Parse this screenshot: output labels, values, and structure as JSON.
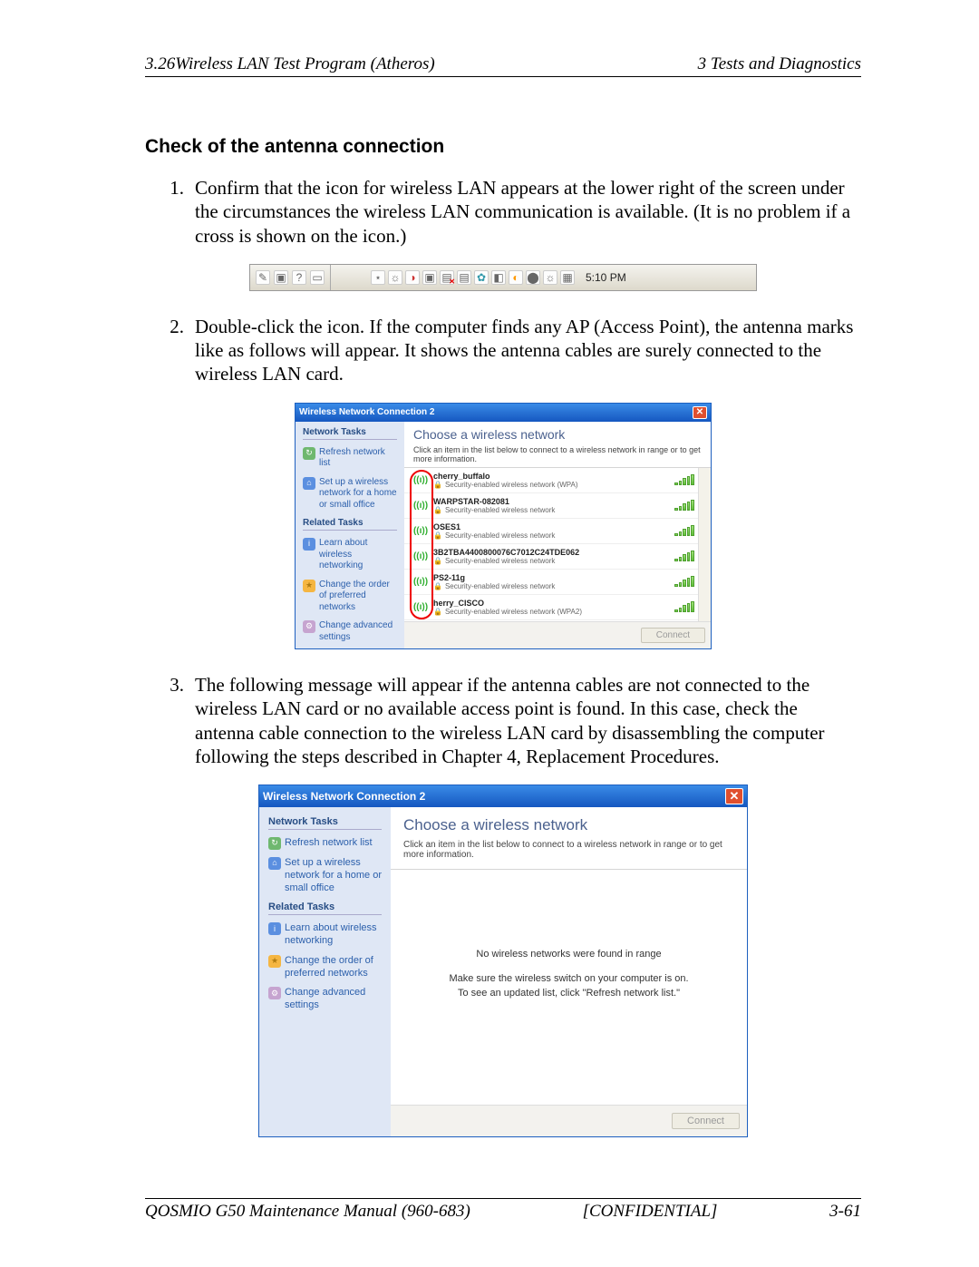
{
  "header": {
    "left": "3.26Wireless LAN Test Program (Atheros)",
    "right": "3  Tests and Diagnostics"
  },
  "section_title": "Check of the antenna connection",
  "steps": [
    {
      "num": "1.",
      "text": "Confirm that the icon for wireless LAN appears at the lower right of the screen under the circumstances the wireless LAN communication is available. (It is no problem if a cross is shown on the icon.)"
    },
    {
      "num": "2.",
      "text": "Double-click the icon. If the computer finds any AP (Access Point), the antenna marks like as follows will appear. It shows the antenna cables are surely connected to the wireless LAN card."
    },
    {
      "num": "3.",
      "text": "The following message will appear if the antenna cables are not connected to the wireless LAN card or no available access point is found. In this case, check the antenna cable connection to the wireless LAN card by disassembling the computer following the steps described in Chapter 4, Replacement Procedures."
    }
  ],
  "tray": {
    "clock": "5:10 PM"
  },
  "wnc_dialog": {
    "title": "Wireless Network Connection 2",
    "main_title": "Choose a wireless network",
    "subtitle": "Click an item in the list below to connect to a wireless network in range or to get more information.",
    "side": {
      "group1": "Network Tasks",
      "refresh": "Refresh network list",
      "setup": "Set up a wireless network for a home or small office",
      "group2": "Related Tasks",
      "learn": "Learn about wireless networking",
      "order": "Change the order of preferred networks",
      "advanced": "Change advanced settings"
    },
    "networks": [
      {
        "name": "cherry_buffalo",
        "sec": "Security-enabled wireless network (WPA)"
      },
      {
        "name": "WARPSTAR-082081",
        "sec": "Security-enabled wireless network"
      },
      {
        "name": "OSES1",
        "sec": "Security-enabled wireless network"
      },
      {
        "name": "3B2TBA4400800076C7012C24TDE062",
        "sec": "Security-enabled wireless network"
      },
      {
        "name": "PS2-11g",
        "sec": "Security-enabled wireless network"
      },
      {
        "name": "herry_CISCO",
        "sec": "Security-enabled wireless network (WPA2)"
      }
    ],
    "empty": {
      "line1": "No wireless networks were found in range",
      "line2": "Make sure the wireless switch on your computer is on.",
      "line3": "To see an updated list, click \"Refresh network list.\""
    },
    "connect_btn": "Connect"
  },
  "footer": {
    "left": "QOSMIO G50 Maintenance Manual (960-683)",
    "center": "[CONFIDENTIAL]",
    "right": "3-61"
  }
}
